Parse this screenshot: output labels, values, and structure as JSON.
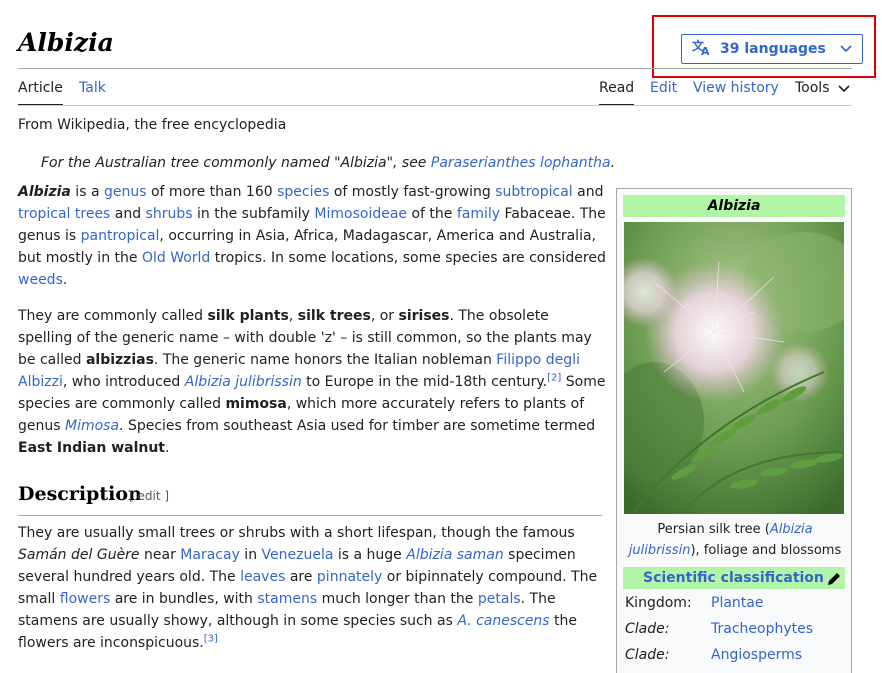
{
  "page": {
    "title": "Albizia",
    "languages_label": "39 languages",
    "tagline": "From Wikipedia, the free encyclopedia"
  },
  "tabs": {
    "article": "Article",
    "talk": "Talk",
    "read": "Read",
    "edit": "Edit",
    "view_history": "View history",
    "tools": "Tools"
  },
  "hatnote": {
    "prefix": "For the Australian tree commonly named \"Albizia\", see ",
    "link": "Paraserianthes lophantha",
    "suffix": "."
  },
  "intro": {
    "p1": [
      {
        "t": "Albizia",
        "s": "bi"
      },
      {
        "t": " is a "
      },
      {
        "t": "genus",
        "l": 1
      },
      {
        "t": " of more than 160 "
      },
      {
        "t": "species",
        "l": 1
      },
      {
        "t": " of mostly fast-growing "
      },
      {
        "t": "subtropical",
        "l": 1
      },
      {
        "t": " and "
      },
      {
        "t": "tropical trees",
        "l": 1
      },
      {
        "t": " and "
      },
      {
        "t": "shrubs",
        "l": 1
      },
      {
        "t": " in the subfamily "
      },
      {
        "t": "Mimosoideae",
        "l": 1
      },
      {
        "t": " of the "
      },
      {
        "t": "family",
        "l": 1
      },
      {
        "t": " Fabaceae. The genus is "
      },
      {
        "t": "pantropical",
        "l": 1
      },
      {
        "t": ", occurring in Asia, Africa, Madagascar, America and Australia, but mostly in the "
      },
      {
        "t": "Old World",
        "l": 1
      },
      {
        "t": " tropics. In some locations, some species are considered "
      },
      {
        "t": "weeds",
        "l": 1
      },
      {
        "t": "."
      }
    ],
    "p2": [
      {
        "t": "They are commonly called "
      },
      {
        "t": "silk plants",
        "s": "b"
      },
      {
        "t": ", "
      },
      {
        "t": "silk trees",
        "s": "b"
      },
      {
        "t": ", or "
      },
      {
        "t": "sirises",
        "s": "b"
      },
      {
        "t": ". The obsolete spelling of the generic name – with double 'z' – is still common, so the plants may be called "
      },
      {
        "t": "albizzias",
        "s": "b"
      },
      {
        "t": ". The generic name honors the Italian nobleman "
      },
      {
        "t": "Filippo degli Albizzi",
        "l": 1
      },
      {
        "t": ", who introduced "
      },
      {
        "t": "Albizia julibrissin",
        "l": 1,
        "s": "i"
      },
      {
        "t": " to Europe in the mid-18th century."
      },
      {
        "t": "[2]",
        "l": 1,
        "s": "sup"
      },
      {
        "t": " Some species are commonly called "
      },
      {
        "t": "mimosa",
        "s": "b"
      },
      {
        "t": ", which more accurately refers to plants of genus "
      },
      {
        "t": "Mimosa",
        "l": 1,
        "s": "i"
      },
      {
        "t": ". Species from southeast Asia used for timber are sometime termed "
      },
      {
        "t": "East Indian walnut",
        "s": "b"
      },
      {
        "t": "."
      }
    ]
  },
  "description": {
    "heading": "Description",
    "edit_label": "[ edit ]",
    "p1": [
      {
        "t": "They are usually small trees or shrubs with a short lifespan, though the famous "
      },
      {
        "t": "Samán del Guère",
        "s": "i"
      },
      {
        "t": " near "
      },
      {
        "t": "Maracay",
        "l": 1
      },
      {
        "t": " in "
      },
      {
        "t": "Venezuela",
        "l": 1
      },
      {
        "t": " is a huge "
      },
      {
        "t": "Albizia saman",
        "l": 1,
        "s": "i"
      },
      {
        "t": " specimen several hundred years old. The "
      },
      {
        "t": "leaves",
        "l": 1
      },
      {
        "t": " are "
      },
      {
        "t": "pinnately",
        "l": 1
      },
      {
        "t": " or bipinnately compound. The small "
      },
      {
        "t": "flowers",
        "l": 1
      },
      {
        "t": " are in bundles, with "
      },
      {
        "t": "stamens",
        "l": 1
      },
      {
        "t": " much longer than the "
      },
      {
        "t": "petals",
        "l": 1
      },
      {
        "t": ". The stamens are usually showy, although in some species such as "
      },
      {
        "t": "A. canescens",
        "l": 1,
        "s": "i"
      },
      {
        "t": " the flowers are inconspicuous."
      },
      {
        "t": "[3]",
        "l": 1,
        "s": "sup"
      }
    ]
  },
  "infobox": {
    "title": "Albizia",
    "caption_pre": "Persian silk tree (",
    "caption_link": "Albizia julibrissin",
    "caption_post": "), foliage and blossoms",
    "sci_label": "Scientific classification",
    "rows": [
      {
        "key": "Kingdom:",
        "value": "Plantae"
      },
      {
        "key": "Clade:",
        "value": "Tracheophytes"
      },
      {
        "key": "Clade:",
        "value": "Angiosperms"
      }
    ]
  },
  "colors": {
    "link": "#3366cc",
    "infobox_header": "#b3f5a7",
    "highlight": "#e00000"
  },
  "icons": [
    "translate-icon",
    "chevron-down-icon",
    "pencil-icon"
  ]
}
